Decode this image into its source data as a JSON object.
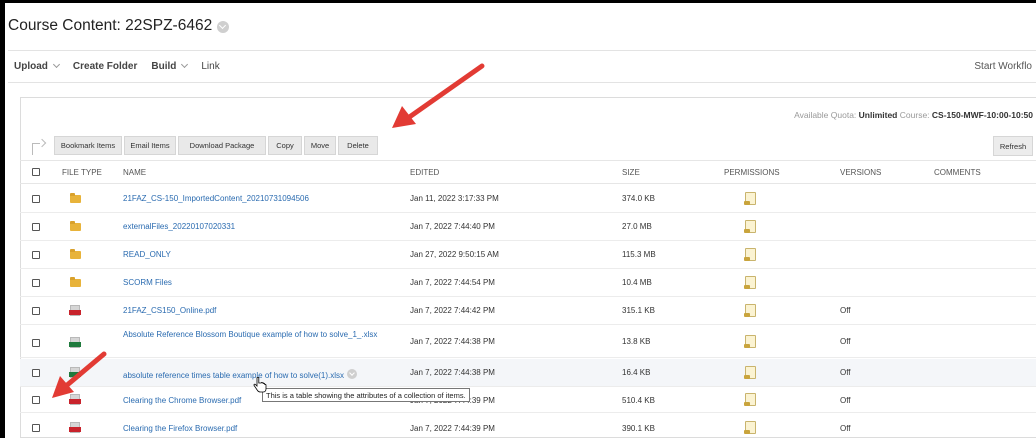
{
  "page": {
    "title": "Course Content: 22SPZ-6462"
  },
  "toolbar": {
    "upload_label": "Upload",
    "create_folder_label": "Create Folder",
    "build_label": "Build",
    "link_label": "Link",
    "start_workflow_label": "Start Workflo"
  },
  "quota": {
    "prefix": "Available Quota:",
    "value": "Unlimited",
    "course_prefix": "Course:",
    "course_value": "CS-150-MWF-10:00-10:50"
  },
  "actions": {
    "bookmark_items": "Bookmark Items",
    "email_items": "Email Items",
    "download_package": "Download Package",
    "copy": "Copy",
    "move": "Move",
    "delete": "Delete",
    "refresh": "Refresh"
  },
  "table": {
    "columns": {
      "file_type": "FILE TYPE",
      "name": "NAME",
      "edited": "EDITED",
      "size": "SIZE",
      "permissions": "PERMISSIONS",
      "versions": "VERSIONS",
      "comments": "COMMENTS"
    },
    "rows": [
      {
        "type": "folder-icon",
        "name": "21FAZ_CS-150_ImportedContent_20210731094506",
        "edited": "Jan 11, 2022 3:17:33 PM",
        "size": "374.0 KB",
        "versions": ""
      },
      {
        "type": "folder-icon",
        "name": "externalFiles_20220107020331",
        "edited": "Jan 7, 2022 7:44:40 PM",
        "size": "27.0 MB",
        "versions": ""
      },
      {
        "type": "folder-icon",
        "name": "READ_ONLY",
        "edited": "Jan 27, 2022 9:50:15 AM",
        "size": "115.3 MB",
        "versions": ""
      },
      {
        "type": "folder-icon",
        "name": "SCORM Files",
        "edited": "Jan 7, 2022 7:44:54 PM",
        "size": "10.4 MB",
        "versions": ""
      },
      {
        "type": "pdf-icon",
        "name": "21FAZ_CS150_Online.pdf",
        "edited": "Jan 7, 2022 7:44:42 PM",
        "size": "315.1 KB",
        "versions": "Off"
      },
      {
        "type": "xlsx-icon",
        "name": "Absolute Reference Blossom Boutique example of how to solve_1_.xlsx",
        "edited": "Jan 7, 2022 7:44:38 PM",
        "size": "13.8 KB",
        "versions": "Off"
      },
      {
        "type": "xlsx-icon",
        "name": "absolute reference times table example of how to solve(1).xlsx",
        "edited": "Jan 7, 2022 7:44:38 PM",
        "size": "16.4 KB",
        "versions": "Off"
      },
      {
        "type": "pdf-icon",
        "name": "Clearing the Chrome Browser.pdf",
        "edited": "Jan 7, 2022 7:44:39 PM",
        "size": "510.4 KB",
        "versions": "Off"
      },
      {
        "type": "pdf-icon",
        "name": "Clearing the Firefox Browser.pdf",
        "edited": "Jan 7, 2022 7:44:39 PM",
        "size": "390.1 KB",
        "versions": "Off"
      }
    ]
  },
  "tooltip": {
    "text": "This is a table showing the attributes of a collection of items."
  },
  "colors": {
    "link": "#2a6bb0",
    "annotation_arrow": "#e23b34",
    "folder": "#e8b33a",
    "pdf": "#c8232c",
    "xlsx": "#1f7a3d"
  }
}
